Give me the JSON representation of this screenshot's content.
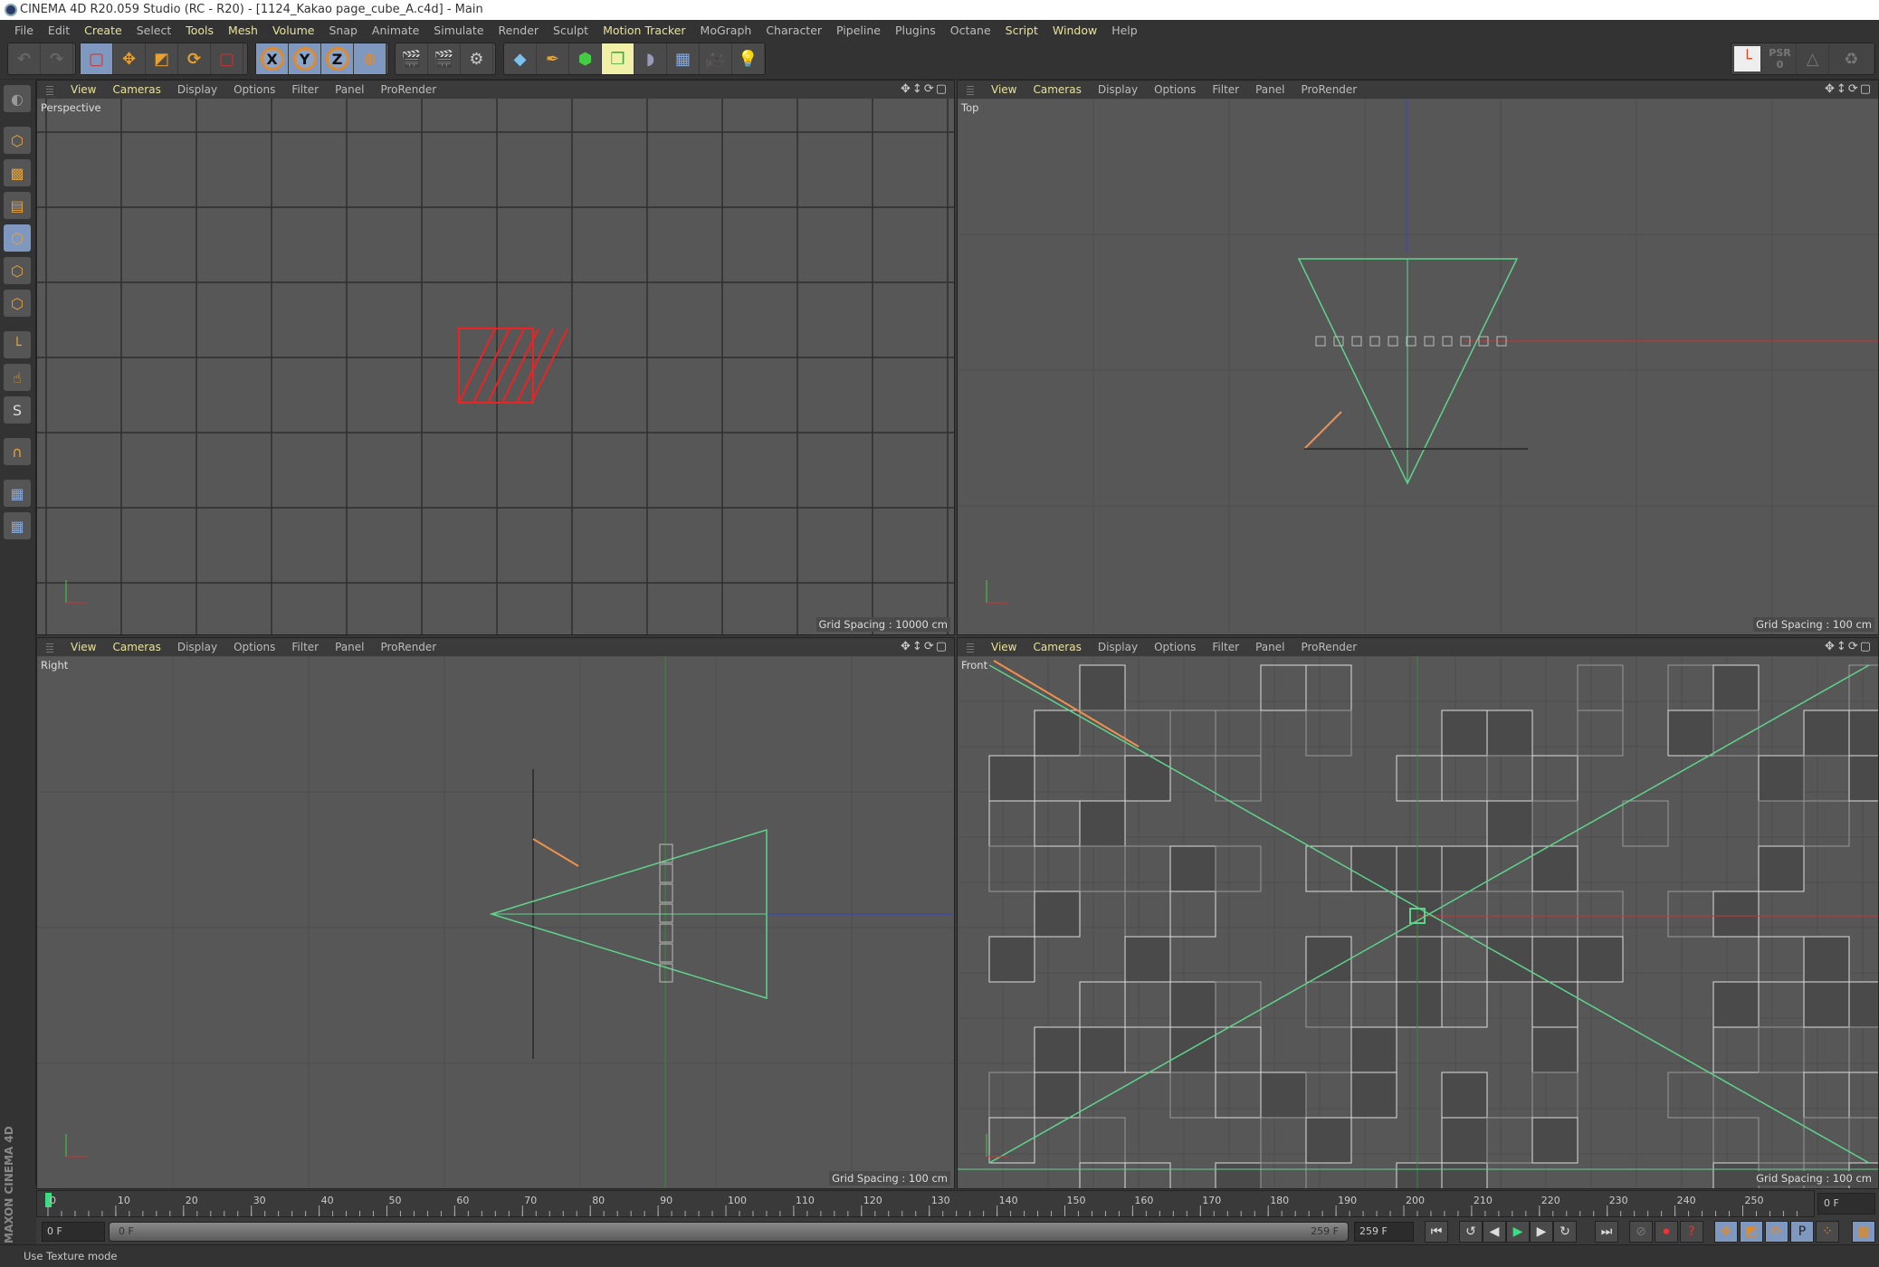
{
  "window": {
    "title": "CINEMA 4D R20.059 Studio (RC - R20) - [1124_Kakao page_cube_A.c4d] - Main"
  },
  "menu": [
    {
      "label": "File",
      "hi": false
    },
    {
      "label": "Edit",
      "hi": false
    },
    {
      "label": "Create",
      "hi": true
    },
    {
      "label": "Select",
      "hi": false
    },
    {
      "label": "Tools",
      "hi": true
    },
    {
      "label": "Mesh",
      "hi": true
    },
    {
      "label": "Volume",
      "hi": true
    },
    {
      "label": "Snap",
      "hi": false
    },
    {
      "label": "Animate",
      "hi": false
    },
    {
      "label": "Simulate",
      "hi": false
    },
    {
      "label": "Render",
      "hi": false
    },
    {
      "label": "Sculpt",
      "hi": false
    },
    {
      "label": "Motion Tracker",
      "hi": true
    },
    {
      "label": "MoGraph",
      "hi": false
    },
    {
      "label": "Character",
      "hi": false
    },
    {
      "label": "Pipeline",
      "hi": false
    },
    {
      "label": "Plugins",
      "hi": false
    },
    {
      "label": "Octane",
      "hi": false
    },
    {
      "label": "Script",
      "hi": true
    },
    {
      "label": "Window",
      "hi": true
    },
    {
      "label": "Help",
      "hi": false
    }
  ],
  "toolbar": {
    "axis_x": "X",
    "axis_y": "Y",
    "axis_z": "Z",
    "psr_label": "PSR",
    "psr_value": "0"
  },
  "viewport_menu": [
    "View",
    "Cameras",
    "Display",
    "Options",
    "Filter",
    "Panel",
    "ProRender"
  ],
  "viewports": [
    {
      "name": "Perspective",
      "grid": "Grid Spacing : 10000 cm"
    },
    {
      "name": "Top",
      "grid": "Grid Spacing : 100 cm"
    },
    {
      "name": "Right",
      "grid": "Grid Spacing : 100 cm"
    },
    {
      "name": "Front",
      "grid": "Grid Spacing : 100 cm"
    }
  ],
  "timeline": {
    "ticks": [
      0,
      10,
      20,
      30,
      40,
      50,
      60,
      70,
      80,
      90,
      100,
      110,
      120,
      130,
      140,
      150,
      160,
      170,
      180,
      190,
      200,
      210,
      220,
      230,
      240,
      250
    ],
    "current_frame": "0 F",
    "start": "0 F",
    "range_start": "0 F",
    "range_end": "259 F",
    "end": "259 F"
  },
  "colors": {
    "accent": "#7e98bf",
    "highlight": "#e8e29a",
    "camera": "#5fd38c",
    "playhead": "#3ddc84"
  },
  "status": {
    "text": "Use Texture mode"
  },
  "brand": "MAXON CINEMA 4D"
}
